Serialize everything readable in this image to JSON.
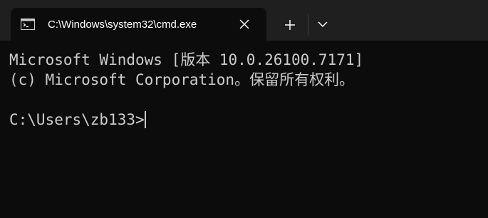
{
  "tab": {
    "title": "C:\\Windows\\system32\\cmd.exe",
    "icon": "terminal-icon"
  },
  "toolbar": {
    "close_icon": "close-icon",
    "new_tab_icon": "plus-icon",
    "dropdown_icon": "chevron-down-icon"
  },
  "console": {
    "lines": [
      "Microsoft Windows [版本 10.0.26100.7171]",
      "(c) Microsoft Corporation。保留所有权利。",
      "",
      "C:\\Users\\zb133>"
    ]
  },
  "colors": {
    "titlebar_bg": "#1f1f1f",
    "console_bg": "#0c0c0c",
    "console_text": "#cccccc",
    "tab_text": "#ffffff"
  }
}
